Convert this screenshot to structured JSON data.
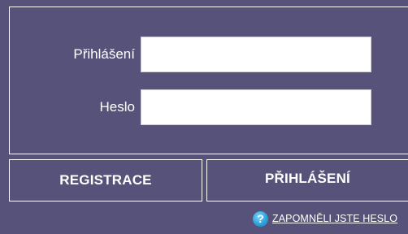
{
  "login_form": {
    "username": {
      "label": "Přihlášení",
      "value": "",
      "placeholder": ""
    },
    "password": {
      "label": "Heslo",
      "value": "",
      "placeholder": ""
    }
  },
  "actions": {
    "register_label": "REGISTRACE",
    "login_label": "PŘIHLÁŠENÍ"
  },
  "forgot_password": {
    "icon": "help-icon",
    "icon_glyph": "?",
    "label": "ZAPOMNĚLI JSTE HESLO"
  },
  "colors": {
    "background": "#575279",
    "border": "#ffffff",
    "help_icon": "#2ea3dc"
  }
}
